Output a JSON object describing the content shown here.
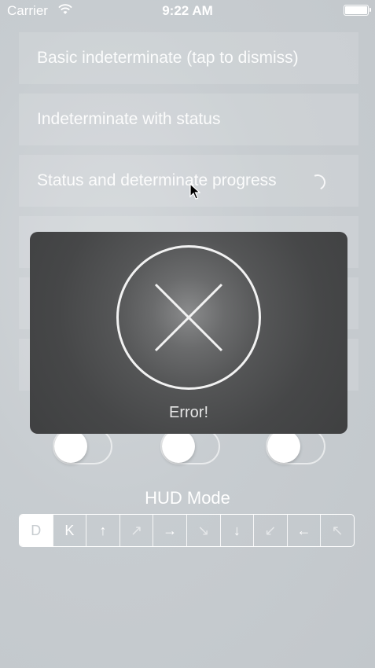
{
  "status_bar": {
    "carrier": "Carrier",
    "time": "9:22 AM"
  },
  "menu": {
    "rows": [
      {
        "label": "Basic indeterminate (tap to dismiss)"
      },
      {
        "label": "Indeterminate with status"
      },
      {
        "label": "Status and determinate progress"
      },
      {
        "label": ""
      },
      {
        "label": ""
      },
      {
        "label": ""
      }
    ]
  },
  "options": {
    "labels": [
      "",
      "",
      ""
    ]
  },
  "hud_mode": {
    "title": "HUD Mode",
    "segments": [
      "D",
      "K",
      "↑",
      "↗",
      "→",
      "↘",
      "↓",
      "↙",
      "←",
      "↖"
    ]
  },
  "hud": {
    "status": "Error!",
    "icon": "error-x-icon"
  }
}
